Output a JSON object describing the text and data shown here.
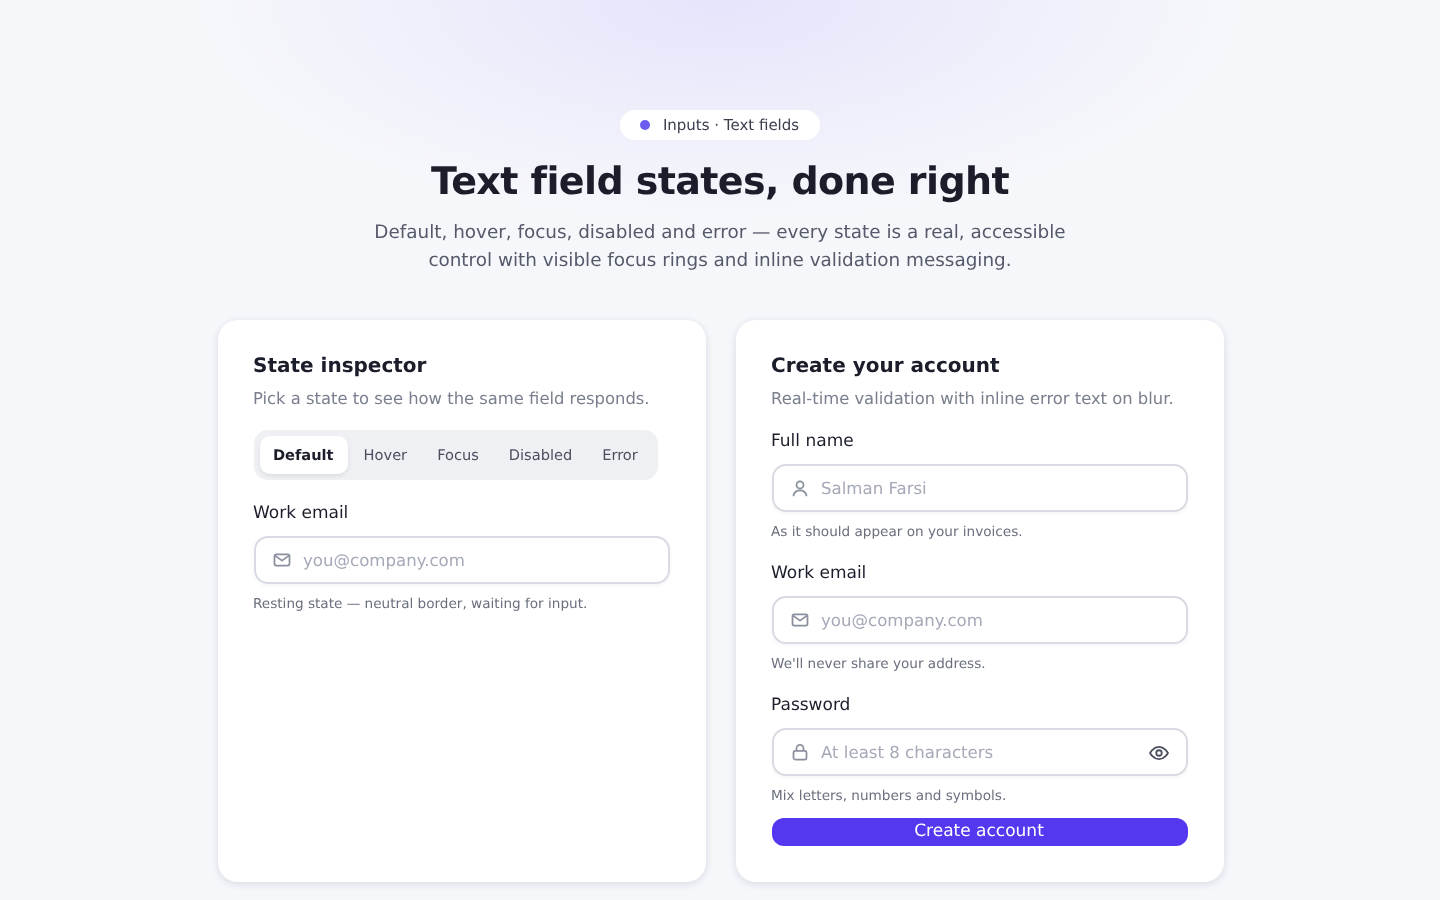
{
  "badge": "Inputs · Text fields",
  "title": "Text field states, done right",
  "subtitle": "Default, hover, focus, disabled and error — every state is a real, accessible control with visible focus rings and inline validation messaging.",
  "inspector": {
    "title": "State inspector",
    "description": "Pick a state to see how the same field responds.",
    "tabs": [
      {
        "label": "Default",
        "selected": true
      },
      {
        "label": "Hover",
        "selected": false
      },
      {
        "label": "Focus",
        "selected": false
      },
      {
        "label": "Disabled",
        "selected": false
      },
      {
        "label": "Error",
        "selected": false
      }
    ],
    "field": {
      "label": "Work email",
      "kind": "mail",
      "placeholder": "you@company.com",
      "hint": "Resting state — neutral border, waiting for input."
    }
  },
  "signup": {
    "title": "Create your account",
    "description": "Real-time validation with inline error text on blur.",
    "fields": [
      {
        "label": "Full name",
        "kind": "person",
        "placeholder": "Salman Farsi",
        "hint": "As it should appear on your invoices."
      },
      {
        "label": "Work email",
        "kind": "mail",
        "placeholder": "you@company.com",
        "hint": "We'll never share your address."
      },
      {
        "label": "Password",
        "kind": "lock",
        "placeholder": "At least 8 characters",
        "hint": "Mix letters, numbers and symbols.",
        "reveal": true
      }
    ],
    "button": "Create account"
  }
}
